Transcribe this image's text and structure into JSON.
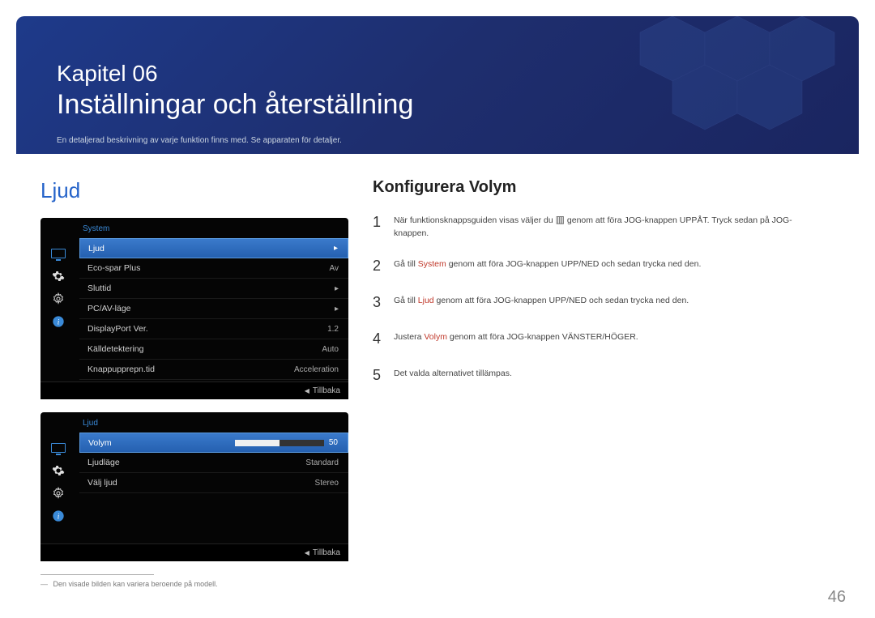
{
  "chapter": {
    "label": "Kapitel 06",
    "title": "Inställningar och återställning",
    "subtitle": "En detaljerad beskrivning av varje funktion finns med. Se apparaten för detaljer."
  },
  "section_title_left": "Ljud",
  "section_title_right": "Konfigurera Volym",
  "osd1": {
    "header": "System",
    "rows": [
      {
        "label": "Ljud",
        "value": "▸",
        "selected": true
      },
      {
        "label": "Eco-spar Plus",
        "value": "Av"
      },
      {
        "label": "Sluttid",
        "value": "▸"
      },
      {
        "label": "PC/AV-läge",
        "value": "▸"
      },
      {
        "label": "DisplayPort Ver.",
        "value": "1.2"
      },
      {
        "label": "Källdetektering",
        "value": "Auto"
      },
      {
        "label": "Knappupprepn.tid",
        "value": "Acceleration"
      }
    ],
    "footer_label": "Tillbaka"
  },
  "osd2": {
    "header": "Ljud",
    "rows": [
      {
        "label": "Volym",
        "value": "50",
        "selected": true,
        "slider": true
      },
      {
        "label": "Ljudläge",
        "value": "Standard"
      },
      {
        "label": "Välj ljud",
        "value": "Stereo"
      }
    ],
    "footer_label": "Tillbaka"
  },
  "steps": {
    "s1_a": "När funktionsknappsguiden visas väljer du ",
    "s1_b": " genom att föra JOG-knappen UPPÅT. Tryck sedan på JOG-knappen.",
    "s2_a": "Gå till ",
    "s2_kw": "System",
    "s2_b": " genom att föra JOG-knappen UPP/NED och sedan trycka ned den.",
    "s3_a": "Gå till ",
    "s3_kw": "Ljud",
    "s3_b": " genom att föra JOG-knappen UPP/NED och sedan trycka ned den.",
    "s4_a": "Justera ",
    "s4_kw": "Volym",
    "s4_b": " genom att föra JOG-knappen VÄNSTER/HÖGER.",
    "s5": "Det valda alternativet tillämpas."
  },
  "footnote": "Den visade bilden kan variera beroende på modell.",
  "page_number": "46",
  "step_numbers": {
    "n1": "1",
    "n2": "2",
    "n3": "3",
    "n4": "4",
    "n5": "5"
  }
}
